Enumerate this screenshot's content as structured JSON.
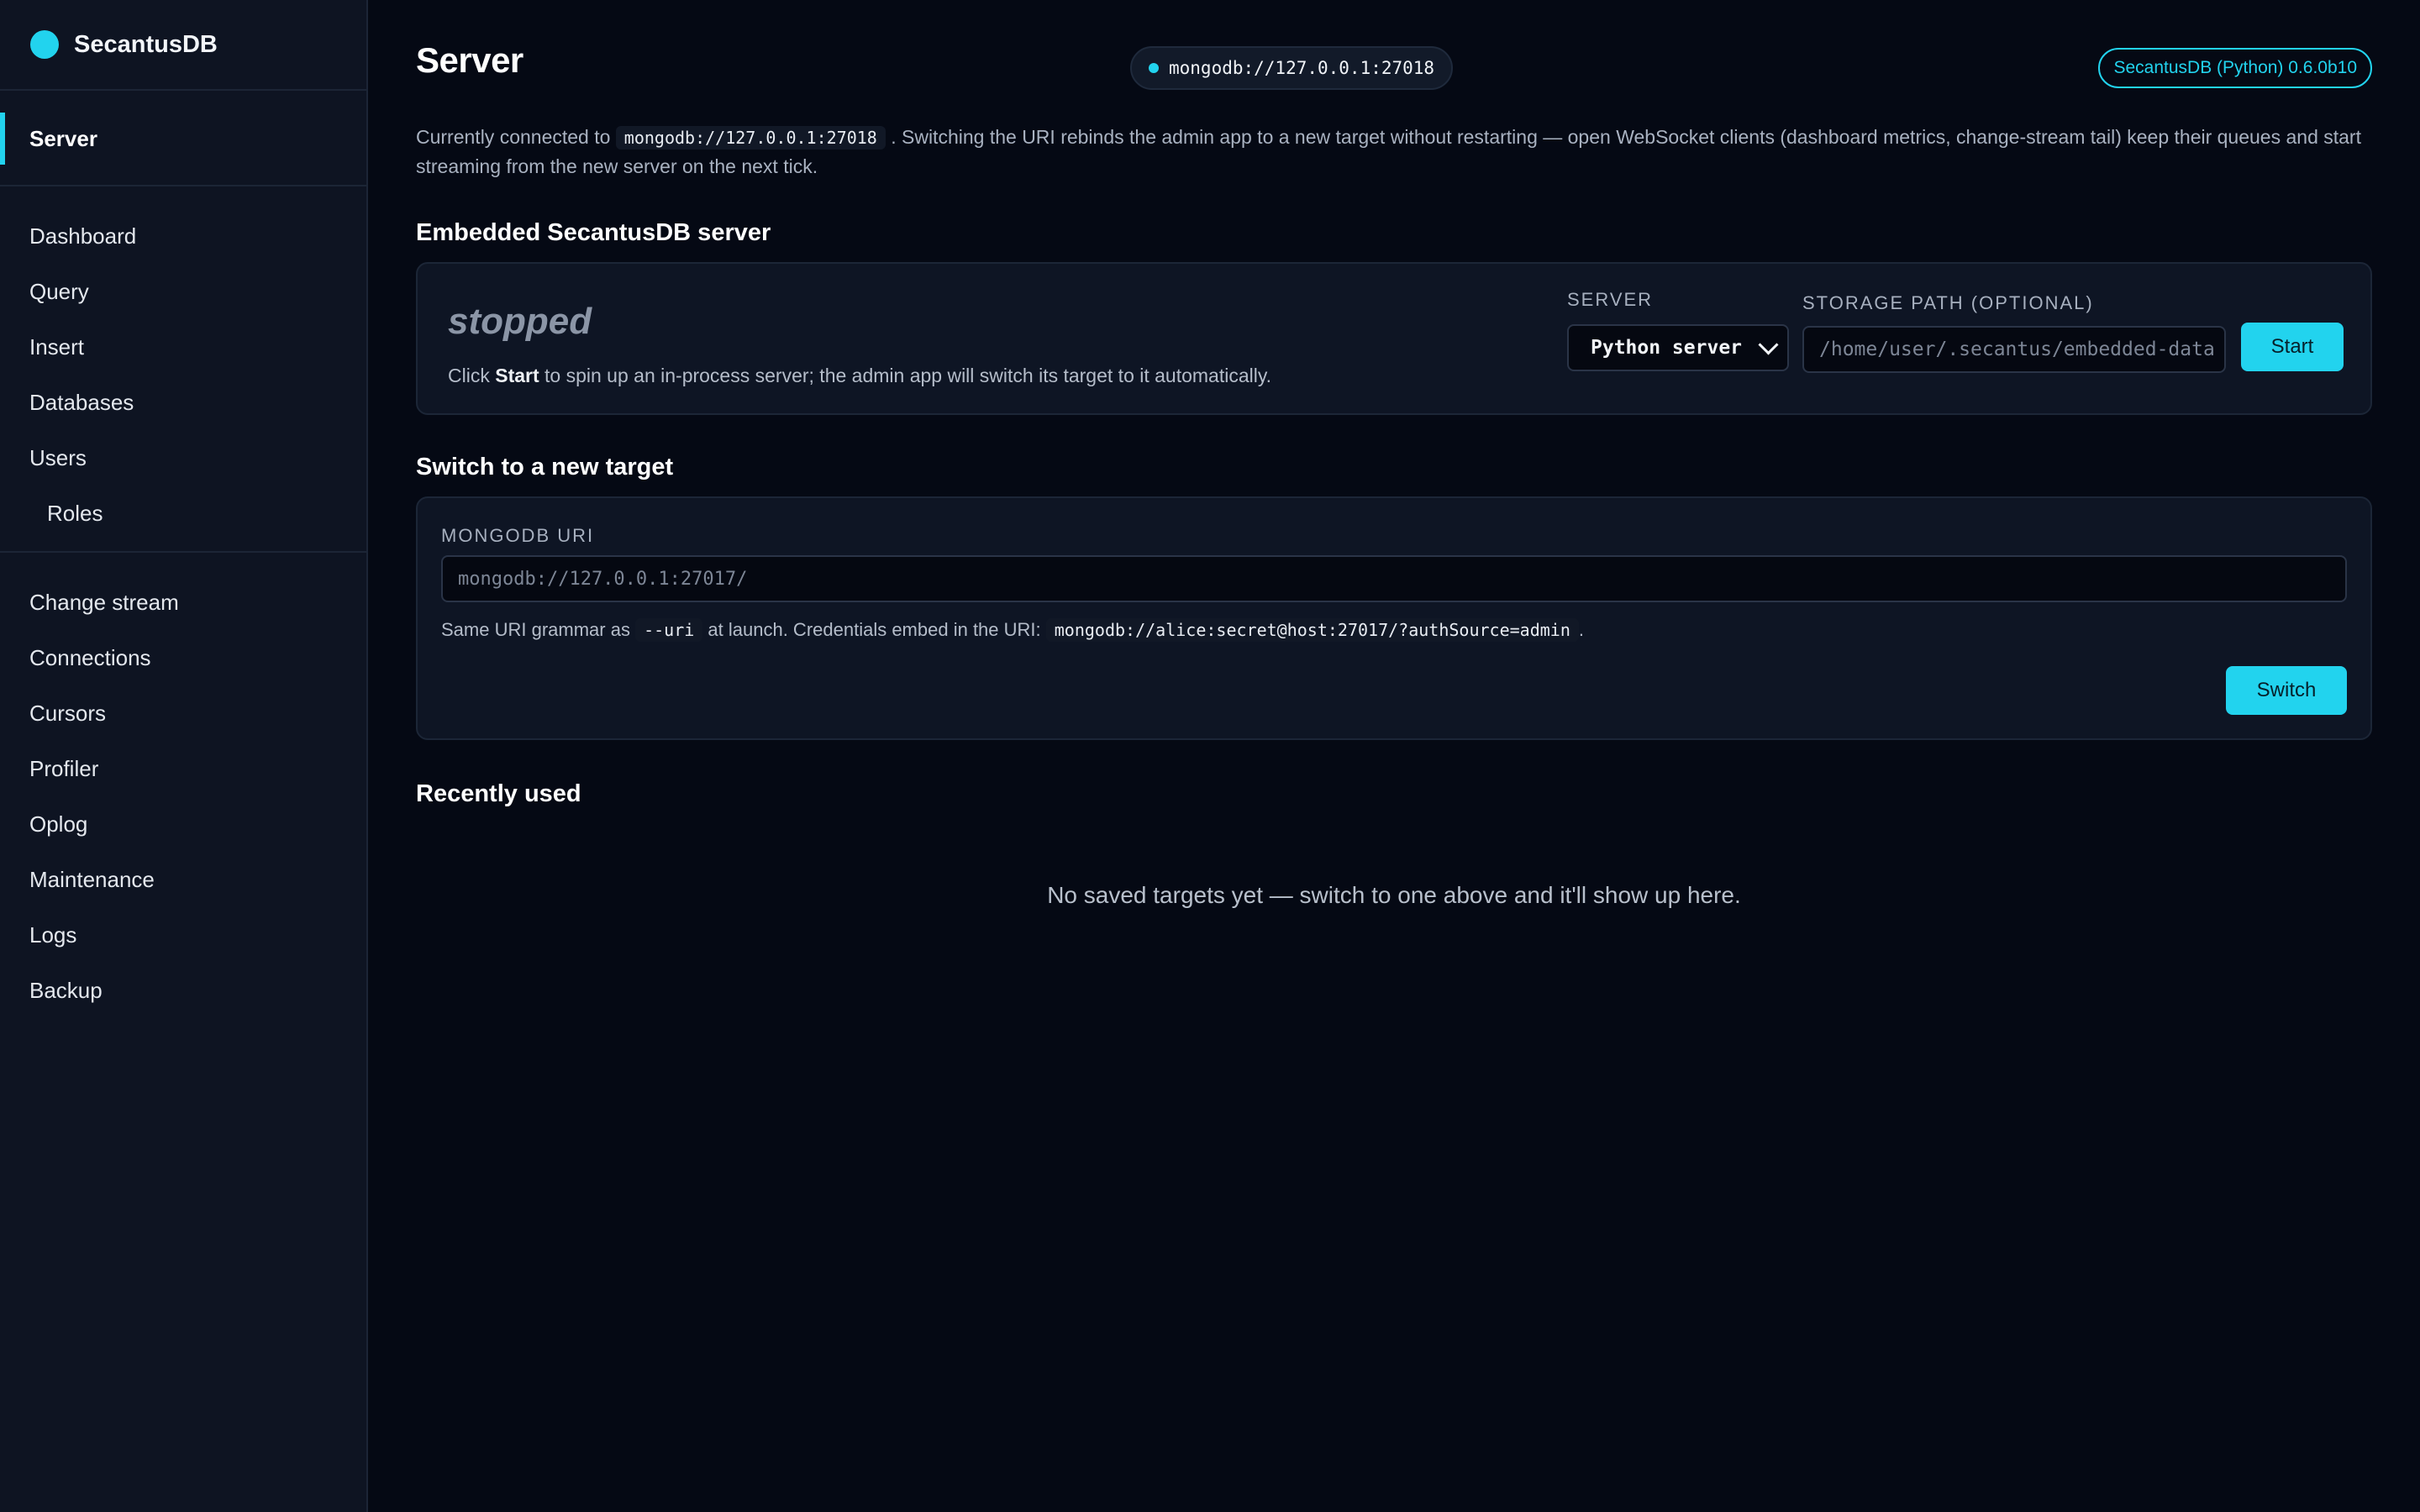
{
  "brand": {
    "name": "SecantusDB",
    "accent": "#22d3ee"
  },
  "sidebar": {
    "groups": [
      {
        "items": [
          {
            "label": "Server",
            "active": true
          }
        ]
      },
      {
        "items": [
          {
            "label": "Dashboard"
          },
          {
            "label": "Query"
          },
          {
            "label": "Insert"
          },
          {
            "label": "Databases"
          },
          {
            "label": "Users"
          },
          {
            "label": "Roles"
          }
        ]
      },
      {
        "items": [
          {
            "label": "Change stream"
          },
          {
            "label": "Connections"
          },
          {
            "label": "Cursors"
          },
          {
            "label": "Profiler"
          },
          {
            "label": "Oplog"
          },
          {
            "label": "Maintenance"
          },
          {
            "label": "Logs"
          },
          {
            "label": "Backup"
          }
        ]
      }
    ]
  },
  "header": {
    "title": "Server",
    "connection": "mongodb://127.0.0.1:27018",
    "version": "SecantusDB (Python) 0.6.0b10"
  },
  "intro": {
    "prefix": "Currently connected to",
    "uri": "mongodb://127.0.0.1:27018",
    "suffix": ". Switching the URI rebinds the admin app to a new target without restarting — open WebSocket clients (dashboard metrics, change-stream tail) keep their queues and start streaming from the new server on the next tick."
  },
  "embedded": {
    "title": "Embedded SecantusDB server",
    "status": "stopped",
    "help_prefix": "Click",
    "help_bold": "Start",
    "help_suffix": "to spin up an in-process server; the admin app will switch its target to it automatically.",
    "server_label": "SERVER",
    "server_value": "Python server",
    "storage_label": "STORAGE PATH (OPTIONAL)",
    "storage_placeholder": "/home/user/.secantus/embedded-data",
    "start_label": "Start"
  },
  "switch": {
    "title": "Switch to a new target",
    "uri_label": "MONGODB URI",
    "uri_placeholder": "mongodb://127.0.0.1:27017/",
    "help_prefix": "Same URI grammar as",
    "help_flag": "--uri",
    "help_middle": "at launch. Credentials embed in the URI:",
    "help_example": "mongodb://alice:secret@host:27017/?authSource=admin",
    "help_suffix": ".",
    "button_label": "Switch"
  },
  "recent": {
    "title": "Recently used",
    "empty": "No saved targets yet — switch to one above and it'll show up here."
  }
}
